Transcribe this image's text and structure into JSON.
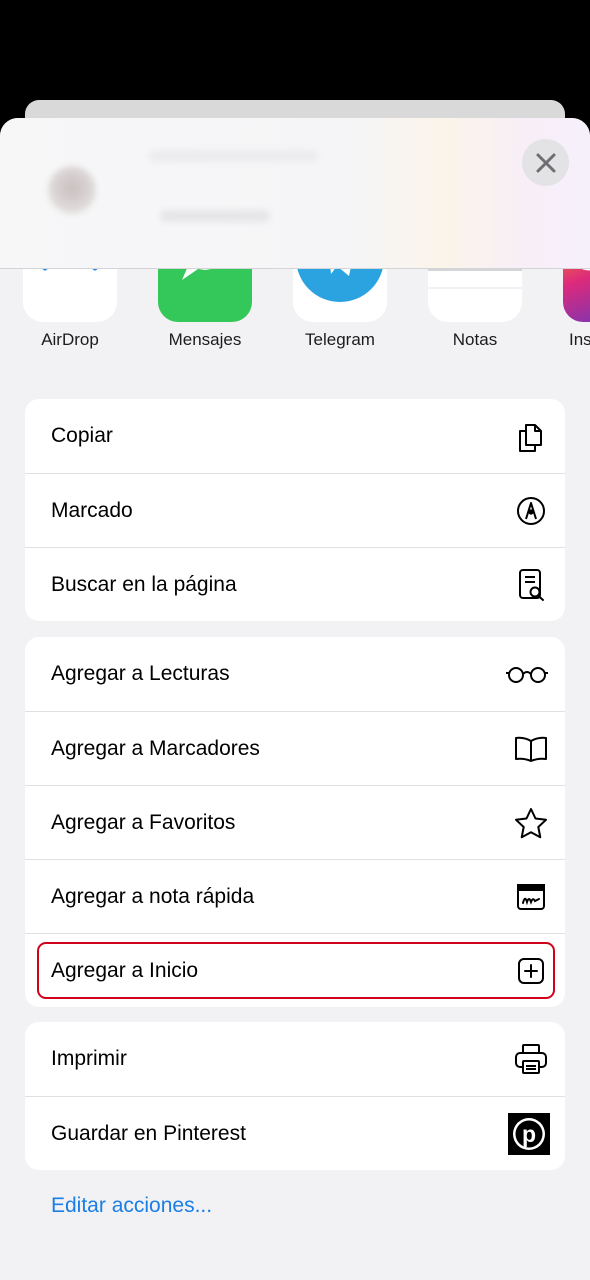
{
  "share_sheet": {
    "apps": [
      {
        "name": "airdrop",
        "label": "AirDrop",
        "icon": "airdrop-icon"
      },
      {
        "name": "mensajes",
        "label": "Mensajes",
        "icon": "messages-icon"
      },
      {
        "name": "telegram",
        "label": "Telegram",
        "icon": "telegram-icon"
      },
      {
        "name": "notas",
        "label": "Notas",
        "icon": "notes-icon"
      },
      {
        "name": "instagram",
        "label": "Ins",
        "icon": "instagram-icon"
      }
    ],
    "groups": [
      [
        {
          "label": "Copiar",
          "icon": "copy-icon"
        },
        {
          "label": "Marcado",
          "icon": "markup-pen-icon"
        },
        {
          "label": "Buscar en la página",
          "icon": "find-in-page-icon"
        }
      ],
      [
        {
          "label": "Agregar a Lecturas",
          "icon": "glasses-icon"
        },
        {
          "label": "Agregar a Marcadores",
          "icon": "book-icon"
        },
        {
          "label": "Agregar a Favoritos",
          "icon": "star-icon"
        },
        {
          "label": "Agregar a nota rápida",
          "icon": "quick-note-icon"
        },
        {
          "label": "Agregar a Inicio",
          "icon": "add-square-icon",
          "highlighted": true
        }
      ],
      [
        {
          "label": "Imprimir",
          "icon": "printer-icon"
        },
        {
          "label": "Guardar en Pinterest",
          "icon": "pinterest-icon"
        }
      ]
    ],
    "edit_actions_label": "Editar acciones...",
    "colors": {
      "link": "#1a7ee6",
      "highlight": "#d0021b",
      "messages_green": "#34c759",
      "telegram_blue": "#2aa3e0",
      "airdrop_blue": "#1a8ff0"
    }
  }
}
